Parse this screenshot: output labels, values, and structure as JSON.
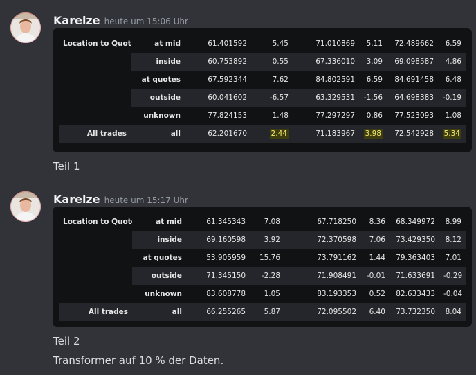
{
  "messages": [
    {
      "username": "Karelze",
      "timestamp": "heute um 15:06 Uhr",
      "caption": "Teil 1",
      "table": {
        "group_label": "Location to Quote",
        "total_label": "All trades",
        "rows": [
          {
            "label": "at mid",
            "c1": "61.401592",
            "c2": "5.45",
            "c3": "71.010869",
            "c4": "5.11",
            "c5": "72.489662",
            "c6": "6.59"
          },
          {
            "label": "inside",
            "c1": "60.753892",
            "c2": "0.55",
            "c3": "67.336010",
            "c4": "3.09",
            "c5": "69.098587",
            "c6": "4.86"
          },
          {
            "label": "at quotes",
            "c1": "67.592344",
            "c2": "7.62",
            "c3": "84.802591",
            "c4": "6.59",
            "c5": "84.691458",
            "c6": "6.48"
          },
          {
            "label": "outside",
            "c1": "60.041602",
            "c2": "-6.57",
            "c3": "63.329531",
            "c4": "-1.56",
            "c5": "64.698383",
            "c6": "-0.19"
          },
          {
            "label": "unknown",
            "c1": "77.824153",
            "c2": "1.48",
            "c3": "77.297297",
            "c4": "0.86",
            "c5": "77.523093",
            "c6": "1.08"
          },
          {
            "label": "all",
            "c1": "62.201670",
            "c2": "2.44",
            "c3": "71.183967",
            "c4": "3.98",
            "c5": "72.542928",
            "c6": "5.34"
          }
        ]
      }
    },
    {
      "username": "Karelze",
      "timestamp": "heute um 15:17 Uhr",
      "caption": "Teil 2",
      "caption2": "Transformer auf 10 % der Daten.",
      "table": {
        "group_label": "Location to Quote",
        "total_label": "All trades",
        "rows": [
          {
            "label": "at mid",
            "c1": "61.345343",
            "c2": "7.08",
            "c3": "67.718250",
            "c4": "8.36",
            "c5": "68.349972",
            "c6": "8.99"
          },
          {
            "label": "inside",
            "c1": "69.160598",
            "c2": "3.92",
            "c3": "72.370598",
            "c4": "7.06",
            "c5": "73.429350",
            "c6": "8.12"
          },
          {
            "label": "at quotes",
            "c1": "53.905959",
            "c2": "15.76",
            "c3": "73.791162",
            "c4": "1.44",
            "c5": "79.363403",
            "c6": "7.01"
          },
          {
            "label": "outside",
            "c1": "71.345150",
            "c2": "-2.28",
            "c3": "71.908491",
            "c4": "-0.01",
            "c5": "71.633691",
            "c6": "-0.29"
          },
          {
            "label": "unknown",
            "c1": "83.608778",
            "c2": "1.05",
            "c3": "83.193353",
            "c4": "0.52",
            "c5": "82.633433",
            "c6": "-0.04"
          },
          {
            "label": "all",
            "c1": "66.255265",
            "c2": "5.87",
            "c3": "72.095502",
            "c4": "6.40",
            "c5": "73.732350",
            "c6": "8.04"
          }
        ]
      }
    }
  ],
  "colors": {
    "background": "#313338",
    "embed": "#111214",
    "highlight_text": "#f2e86a",
    "highlight_bg": "#3d3d10"
  },
  "icons": {
    "avatar": "user-avatar-photo"
  }
}
